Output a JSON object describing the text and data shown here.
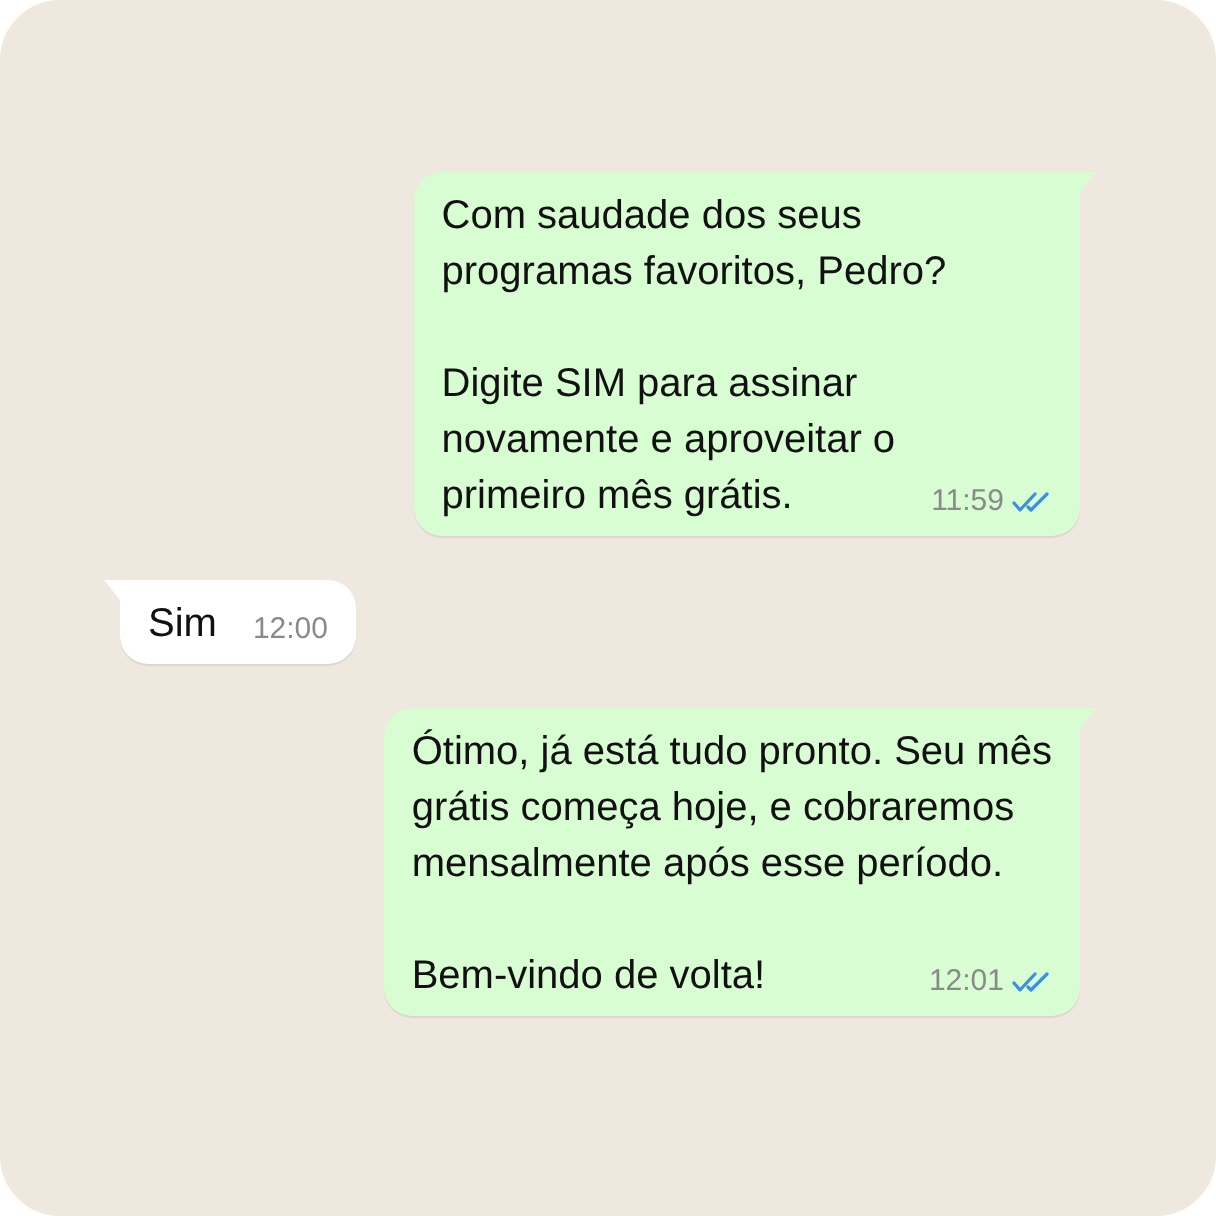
{
  "messages": [
    {
      "kind": "outgoing",
      "paragraphs": [
        "Com saudade dos seus\nprogramas favoritos, Pedro?",
        "Digite SIM para assinar\nnovamente e aproveitar o\nprimeiro mês grátis."
      ],
      "time": "11:59",
      "read": true
    },
    {
      "kind": "incoming",
      "paragraphs": [
        "Sim"
      ],
      "time": "12:00"
    },
    {
      "kind": "outgoing",
      "paragraphs": [
        "Ótimo, já está tudo pronto. Seu mês\ngrátis começa hoje, e cobraremos\nmensalmente após esse período.",
        "Bem-vindo de volta!"
      ],
      "time": "12:01",
      "read": true
    }
  ]
}
